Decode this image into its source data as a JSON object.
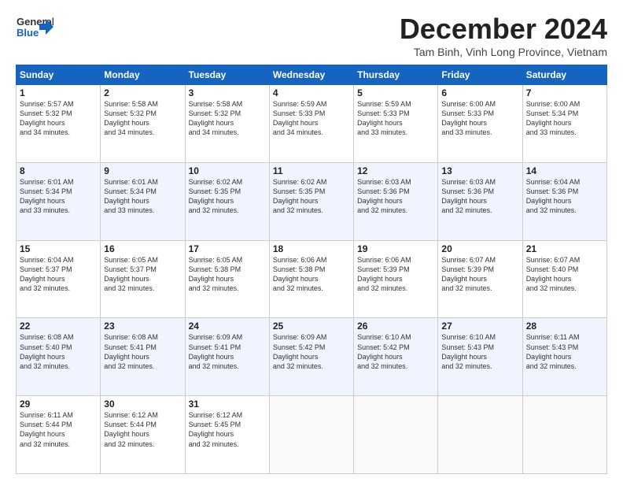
{
  "header": {
    "logo_general": "General",
    "logo_blue": "Blue",
    "month_title": "December 2024",
    "location": "Tam Binh, Vinh Long Province, Vietnam"
  },
  "weekdays": [
    "Sunday",
    "Monday",
    "Tuesday",
    "Wednesday",
    "Thursday",
    "Friday",
    "Saturday"
  ],
  "weeks": [
    [
      {
        "day": "1",
        "sunrise": "5:57 AM",
        "sunset": "5:32 PM",
        "daylight": "11 hours and 34 minutes."
      },
      {
        "day": "2",
        "sunrise": "5:58 AM",
        "sunset": "5:32 PM",
        "daylight": "11 hours and 34 minutes."
      },
      {
        "day": "3",
        "sunrise": "5:58 AM",
        "sunset": "5:32 PM",
        "daylight": "11 hours and 34 minutes."
      },
      {
        "day": "4",
        "sunrise": "5:59 AM",
        "sunset": "5:33 PM",
        "daylight": "11 hours and 34 minutes."
      },
      {
        "day": "5",
        "sunrise": "5:59 AM",
        "sunset": "5:33 PM",
        "daylight": "11 hours and 33 minutes."
      },
      {
        "day": "6",
        "sunrise": "6:00 AM",
        "sunset": "5:33 PM",
        "daylight": "11 hours and 33 minutes."
      },
      {
        "day": "7",
        "sunrise": "6:00 AM",
        "sunset": "5:34 PM",
        "daylight": "11 hours and 33 minutes."
      }
    ],
    [
      {
        "day": "8",
        "sunrise": "6:01 AM",
        "sunset": "5:34 PM",
        "daylight": "11 hours and 33 minutes."
      },
      {
        "day": "9",
        "sunrise": "6:01 AM",
        "sunset": "5:34 PM",
        "daylight": "11 hours and 33 minutes."
      },
      {
        "day": "10",
        "sunrise": "6:02 AM",
        "sunset": "5:35 PM",
        "daylight": "11 hours and 32 minutes."
      },
      {
        "day": "11",
        "sunrise": "6:02 AM",
        "sunset": "5:35 PM",
        "daylight": "11 hours and 32 minutes."
      },
      {
        "day": "12",
        "sunrise": "6:03 AM",
        "sunset": "5:36 PM",
        "daylight": "11 hours and 32 minutes."
      },
      {
        "day": "13",
        "sunrise": "6:03 AM",
        "sunset": "5:36 PM",
        "daylight": "11 hours and 32 minutes."
      },
      {
        "day": "14",
        "sunrise": "6:04 AM",
        "sunset": "5:36 PM",
        "daylight": "11 hours and 32 minutes."
      }
    ],
    [
      {
        "day": "15",
        "sunrise": "6:04 AM",
        "sunset": "5:37 PM",
        "daylight": "11 hours and 32 minutes."
      },
      {
        "day": "16",
        "sunrise": "6:05 AM",
        "sunset": "5:37 PM",
        "daylight": "11 hours and 32 minutes."
      },
      {
        "day": "17",
        "sunrise": "6:05 AM",
        "sunset": "5:38 PM",
        "daylight": "11 hours and 32 minutes."
      },
      {
        "day": "18",
        "sunrise": "6:06 AM",
        "sunset": "5:38 PM",
        "daylight": "11 hours and 32 minutes."
      },
      {
        "day": "19",
        "sunrise": "6:06 AM",
        "sunset": "5:39 PM",
        "daylight": "11 hours and 32 minutes."
      },
      {
        "day": "20",
        "sunrise": "6:07 AM",
        "sunset": "5:39 PM",
        "daylight": "11 hours and 32 minutes."
      },
      {
        "day": "21",
        "sunrise": "6:07 AM",
        "sunset": "5:40 PM",
        "daylight": "11 hours and 32 minutes."
      }
    ],
    [
      {
        "day": "22",
        "sunrise": "6:08 AM",
        "sunset": "5:40 PM",
        "daylight": "11 hours and 32 minutes."
      },
      {
        "day": "23",
        "sunrise": "6:08 AM",
        "sunset": "5:41 PM",
        "daylight": "11 hours and 32 minutes."
      },
      {
        "day": "24",
        "sunrise": "6:09 AM",
        "sunset": "5:41 PM",
        "daylight": "11 hours and 32 minutes."
      },
      {
        "day": "25",
        "sunrise": "6:09 AM",
        "sunset": "5:42 PM",
        "daylight": "11 hours and 32 minutes."
      },
      {
        "day": "26",
        "sunrise": "6:10 AM",
        "sunset": "5:42 PM",
        "daylight": "11 hours and 32 minutes."
      },
      {
        "day": "27",
        "sunrise": "6:10 AM",
        "sunset": "5:43 PM",
        "daylight": "11 hours and 32 minutes."
      },
      {
        "day": "28",
        "sunrise": "6:11 AM",
        "sunset": "5:43 PM",
        "daylight": "11 hours and 32 minutes."
      }
    ],
    [
      {
        "day": "29",
        "sunrise": "6:11 AM",
        "sunset": "5:44 PM",
        "daylight": "11 hours and 32 minutes."
      },
      {
        "day": "30",
        "sunrise": "6:12 AM",
        "sunset": "5:44 PM",
        "daylight": "11 hours and 32 minutes."
      },
      {
        "day": "31",
        "sunrise": "6:12 AM",
        "sunset": "5:45 PM",
        "daylight": "11 hours and 32 minutes."
      },
      null,
      null,
      null,
      null
    ]
  ]
}
